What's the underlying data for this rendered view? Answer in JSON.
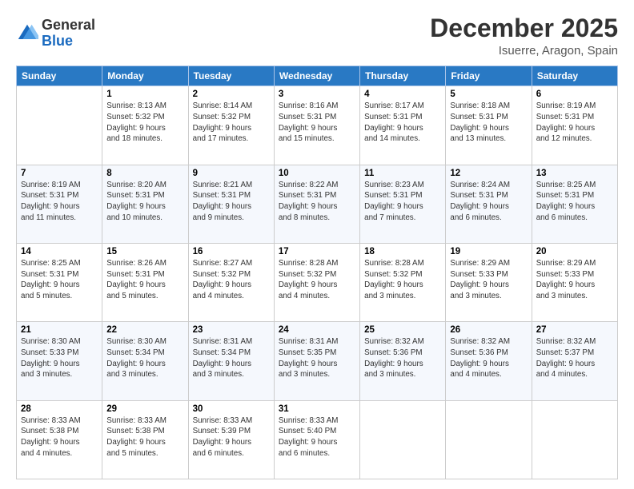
{
  "logo": {
    "general": "General",
    "blue": "Blue"
  },
  "title": "December 2025",
  "location": "Isuerre, Aragon, Spain",
  "days_header": [
    "Sunday",
    "Monday",
    "Tuesday",
    "Wednesday",
    "Thursday",
    "Friday",
    "Saturday"
  ],
  "weeks": [
    [
      {
        "day": "",
        "info": ""
      },
      {
        "day": "1",
        "info": "Sunrise: 8:13 AM\nSunset: 5:32 PM\nDaylight: 9 hours\nand 18 minutes."
      },
      {
        "day": "2",
        "info": "Sunrise: 8:14 AM\nSunset: 5:32 PM\nDaylight: 9 hours\nand 17 minutes."
      },
      {
        "day": "3",
        "info": "Sunrise: 8:16 AM\nSunset: 5:31 PM\nDaylight: 9 hours\nand 15 minutes."
      },
      {
        "day": "4",
        "info": "Sunrise: 8:17 AM\nSunset: 5:31 PM\nDaylight: 9 hours\nand 14 minutes."
      },
      {
        "day": "5",
        "info": "Sunrise: 8:18 AM\nSunset: 5:31 PM\nDaylight: 9 hours\nand 13 minutes."
      },
      {
        "day": "6",
        "info": "Sunrise: 8:19 AM\nSunset: 5:31 PM\nDaylight: 9 hours\nand 12 minutes."
      }
    ],
    [
      {
        "day": "7",
        "info": "Sunrise: 8:19 AM\nSunset: 5:31 PM\nDaylight: 9 hours\nand 11 minutes."
      },
      {
        "day": "8",
        "info": "Sunrise: 8:20 AM\nSunset: 5:31 PM\nDaylight: 9 hours\nand 10 minutes."
      },
      {
        "day": "9",
        "info": "Sunrise: 8:21 AM\nSunset: 5:31 PM\nDaylight: 9 hours\nand 9 minutes."
      },
      {
        "day": "10",
        "info": "Sunrise: 8:22 AM\nSunset: 5:31 PM\nDaylight: 9 hours\nand 8 minutes."
      },
      {
        "day": "11",
        "info": "Sunrise: 8:23 AM\nSunset: 5:31 PM\nDaylight: 9 hours\nand 7 minutes."
      },
      {
        "day": "12",
        "info": "Sunrise: 8:24 AM\nSunset: 5:31 PM\nDaylight: 9 hours\nand 6 minutes."
      },
      {
        "day": "13",
        "info": "Sunrise: 8:25 AM\nSunset: 5:31 PM\nDaylight: 9 hours\nand 6 minutes."
      }
    ],
    [
      {
        "day": "14",
        "info": "Sunrise: 8:25 AM\nSunset: 5:31 PM\nDaylight: 9 hours\nand 5 minutes."
      },
      {
        "day": "15",
        "info": "Sunrise: 8:26 AM\nSunset: 5:31 PM\nDaylight: 9 hours\nand 5 minutes."
      },
      {
        "day": "16",
        "info": "Sunrise: 8:27 AM\nSunset: 5:32 PM\nDaylight: 9 hours\nand 4 minutes."
      },
      {
        "day": "17",
        "info": "Sunrise: 8:28 AM\nSunset: 5:32 PM\nDaylight: 9 hours\nand 4 minutes."
      },
      {
        "day": "18",
        "info": "Sunrise: 8:28 AM\nSunset: 5:32 PM\nDaylight: 9 hours\nand 3 minutes."
      },
      {
        "day": "19",
        "info": "Sunrise: 8:29 AM\nSunset: 5:33 PM\nDaylight: 9 hours\nand 3 minutes."
      },
      {
        "day": "20",
        "info": "Sunrise: 8:29 AM\nSunset: 5:33 PM\nDaylight: 9 hours\nand 3 minutes."
      }
    ],
    [
      {
        "day": "21",
        "info": "Sunrise: 8:30 AM\nSunset: 5:33 PM\nDaylight: 9 hours\nand 3 minutes."
      },
      {
        "day": "22",
        "info": "Sunrise: 8:30 AM\nSunset: 5:34 PM\nDaylight: 9 hours\nand 3 minutes."
      },
      {
        "day": "23",
        "info": "Sunrise: 8:31 AM\nSunset: 5:34 PM\nDaylight: 9 hours\nand 3 minutes."
      },
      {
        "day": "24",
        "info": "Sunrise: 8:31 AM\nSunset: 5:35 PM\nDaylight: 9 hours\nand 3 minutes."
      },
      {
        "day": "25",
        "info": "Sunrise: 8:32 AM\nSunset: 5:36 PM\nDaylight: 9 hours\nand 3 minutes."
      },
      {
        "day": "26",
        "info": "Sunrise: 8:32 AM\nSunset: 5:36 PM\nDaylight: 9 hours\nand 4 minutes."
      },
      {
        "day": "27",
        "info": "Sunrise: 8:32 AM\nSunset: 5:37 PM\nDaylight: 9 hours\nand 4 minutes."
      }
    ],
    [
      {
        "day": "28",
        "info": "Sunrise: 8:33 AM\nSunset: 5:38 PM\nDaylight: 9 hours\nand 4 minutes."
      },
      {
        "day": "29",
        "info": "Sunrise: 8:33 AM\nSunset: 5:38 PM\nDaylight: 9 hours\nand 5 minutes."
      },
      {
        "day": "30",
        "info": "Sunrise: 8:33 AM\nSunset: 5:39 PM\nDaylight: 9 hours\nand 6 minutes."
      },
      {
        "day": "31",
        "info": "Sunrise: 8:33 AM\nSunset: 5:40 PM\nDaylight: 9 hours\nand 6 minutes."
      },
      {
        "day": "",
        "info": ""
      },
      {
        "day": "",
        "info": ""
      },
      {
        "day": "",
        "info": ""
      }
    ]
  ]
}
